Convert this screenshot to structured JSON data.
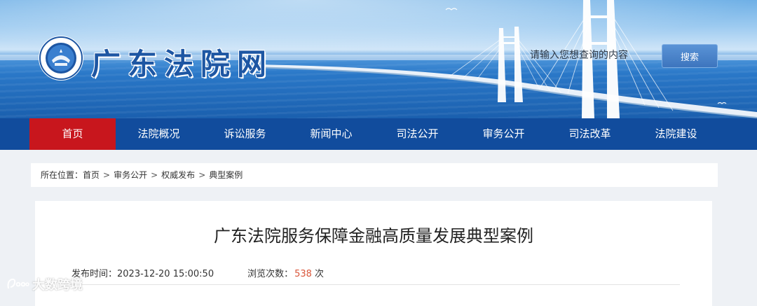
{
  "header": {
    "site_title": "广东法院网",
    "search": {
      "placeholder": "请输入您想查询的内容",
      "button_label": "搜索"
    }
  },
  "nav": {
    "items": [
      {
        "label": "首页",
        "active": true
      },
      {
        "label": "法院概况"
      },
      {
        "label": "诉讼服务"
      },
      {
        "label": "新闻中心"
      },
      {
        "label": "司法公开"
      },
      {
        "label": "审务公开"
      },
      {
        "label": "司法改革"
      },
      {
        "label": "法院建设"
      }
    ]
  },
  "breadcrumb": {
    "prefix": "所在位置：",
    "items": [
      "首页",
      "审务公开",
      "权威发布",
      "典型案例"
    ],
    "separator": ">"
  },
  "article": {
    "title": "广东法院服务保障金融高质量发展典型案例",
    "publish_label": "发布时间：",
    "publish_time": "2023-12-20 15:00:50",
    "views_label": "浏览次数：",
    "views_count": "538",
    "views_unit": "次"
  },
  "watermark": {
    "text": "大数跨境"
  },
  "colors": {
    "nav_bg": "#114c9d",
    "nav_active": "#c8161d",
    "title_blue": "#1d56a3",
    "views_accent": "#d9563a"
  }
}
